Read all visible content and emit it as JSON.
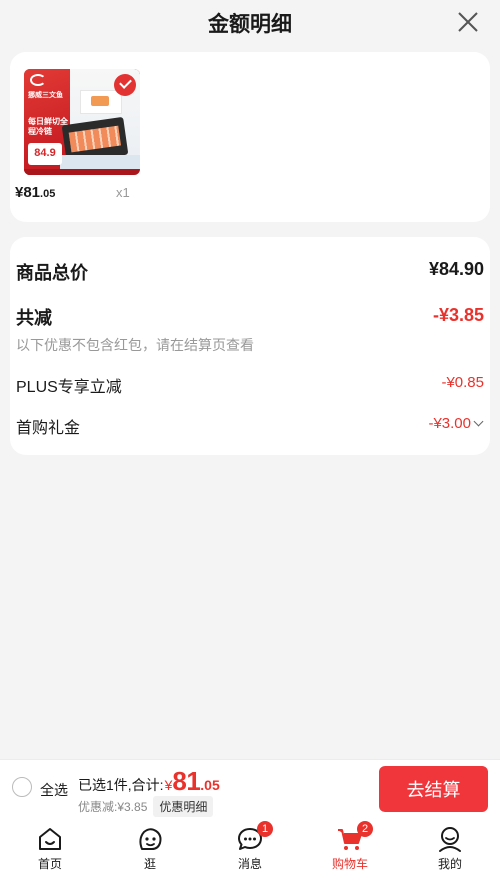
{
  "header": {
    "title": "金额明细"
  },
  "product": {
    "thumb_text_line1": "挪威三文鱼",
    "thumb_text_line3": "每日鲜切全程冷链",
    "thumb_price": "84.9",
    "price_symbol": "¥",
    "price_int": "81",
    "price_dec": ".05",
    "quantity": "x1"
  },
  "summary": {
    "total_label": "商品总价",
    "total_value": "¥84.90",
    "reduce_label": "共减",
    "reduce_value": "-¥3.85",
    "note": "以下优惠不包含红包，请在结算页查看",
    "plus_label": "PLUS专享立减",
    "plus_value": "-¥0.85",
    "gift_label": "首购礼金",
    "gift_value": "-¥3.00"
  },
  "checkout": {
    "select_all": "全选",
    "selected_text": "已选1件,合计:",
    "yen": "¥",
    "amount_int": "81",
    "amount_dec": ".05",
    "discount_text": "优惠减:¥3.85",
    "detail_label": "优惠明细",
    "pay_label": "去结算"
  },
  "tabs": [
    {
      "label": "首页",
      "icon": "home-icon"
    },
    {
      "label": "逛",
      "icon": "face-icon"
    },
    {
      "label": "消息",
      "icon": "message-icon",
      "badge": "1"
    },
    {
      "label": "购物车",
      "icon": "cart-icon",
      "badge": "2",
      "active": true
    },
    {
      "label": "我的",
      "icon": "profile-icon"
    }
  ],
  "colors": {
    "accent": "#e9322c",
    "pay_button": "#f0353b",
    "background": "#f4f4f4"
  }
}
